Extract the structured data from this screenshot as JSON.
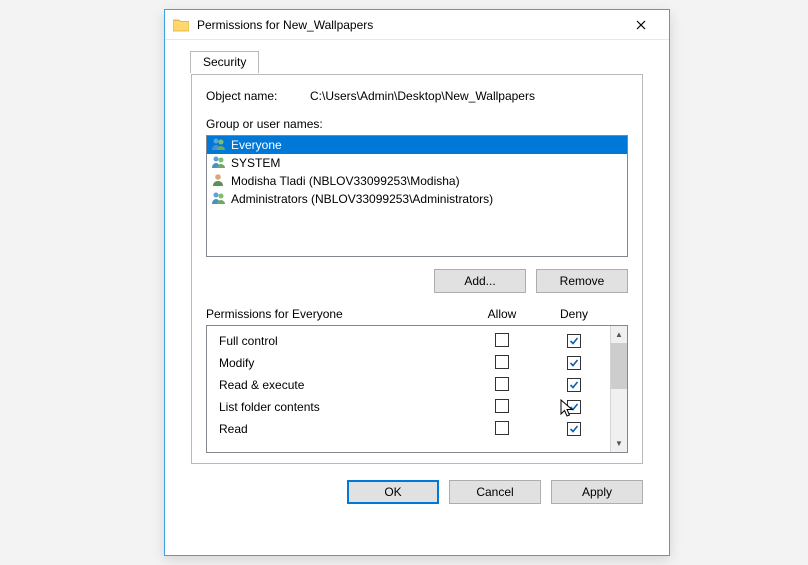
{
  "window": {
    "title": "Permissions for New_Wallpapers"
  },
  "tab": {
    "label": "Security"
  },
  "object": {
    "label": "Object name:",
    "value": "C:\\Users\\Admin\\Desktop\\New_Wallpapers"
  },
  "userlist": {
    "label": "Group or user names:",
    "items": [
      {
        "name": "Everyone",
        "type": "group",
        "selected": true
      },
      {
        "name": "SYSTEM",
        "type": "group",
        "selected": false
      },
      {
        "name": "Modisha Tladi (NBLOV33099253\\Modisha)",
        "type": "user",
        "selected": false
      },
      {
        "name": "Administrators (NBLOV33099253\\Administrators)",
        "type": "group",
        "selected": false
      }
    ]
  },
  "buttons": {
    "add": "Add...",
    "remove": "Remove",
    "ok": "OK",
    "cancel": "Cancel",
    "apply": "Apply"
  },
  "perms": {
    "header_for": "Permissions for Everyone",
    "col_allow": "Allow",
    "col_deny": "Deny",
    "rows": [
      {
        "label": "Full control",
        "allow": false,
        "deny": true
      },
      {
        "label": "Modify",
        "allow": false,
        "deny": true
      },
      {
        "label": "Read & execute",
        "allow": false,
        "deny": true
      },
      {
        "label": "List folder contents",
        "allow": false,
        "deny": true
      },
      {
        "label": "Read",
        "allow": false,
        "deny": true
      }
    ]
  }
}
